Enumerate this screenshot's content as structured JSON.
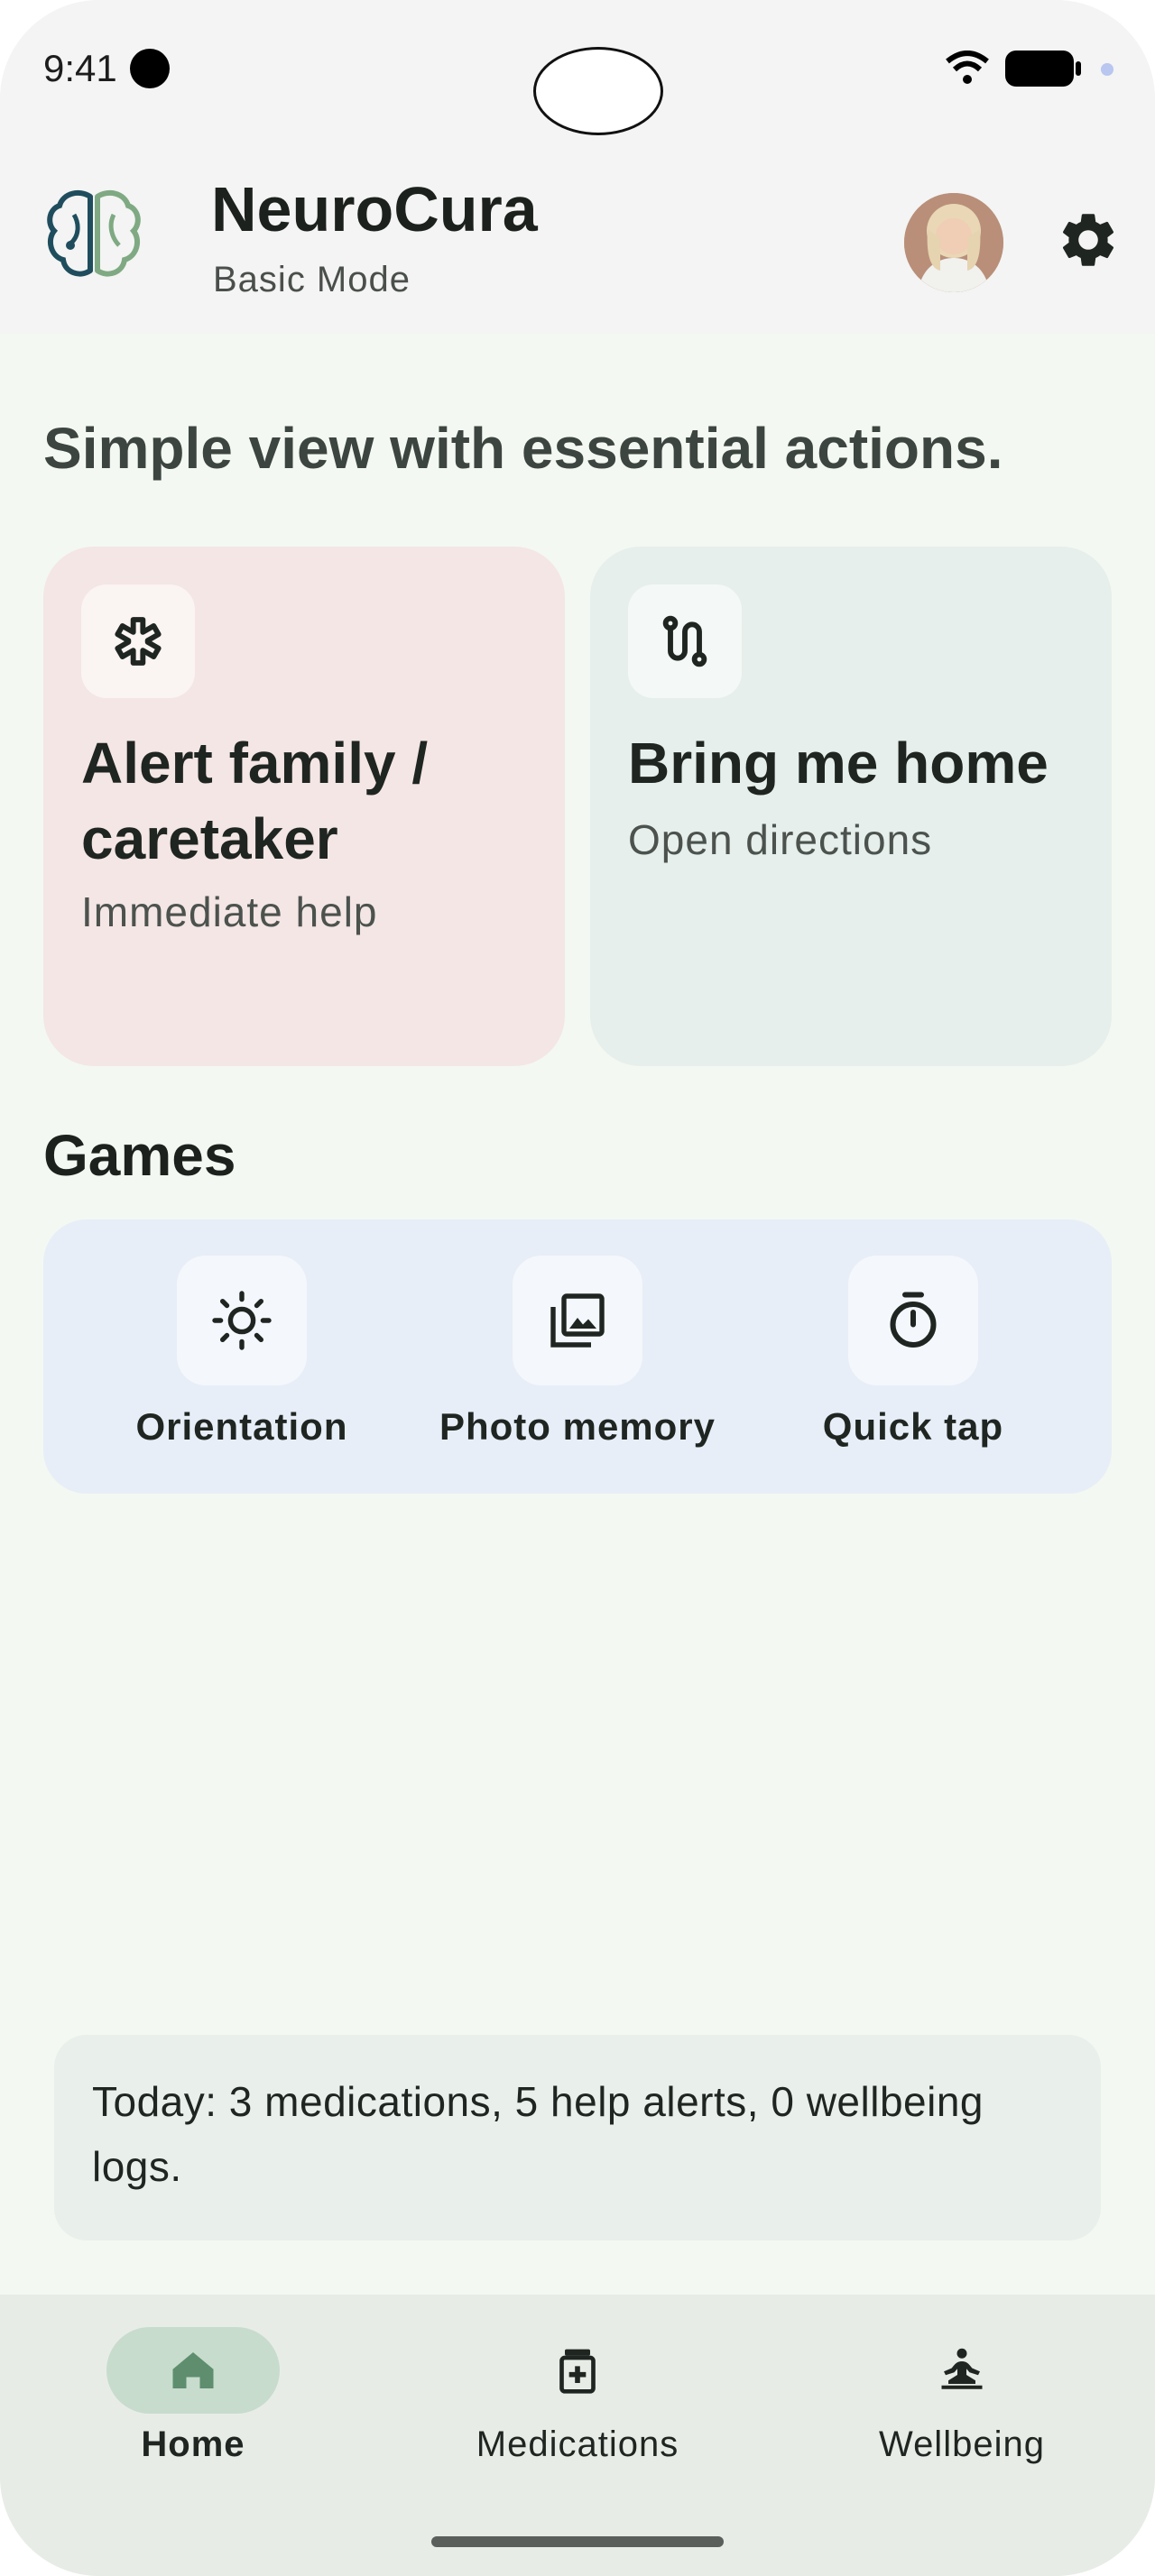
{
  "status_bar": {
    "time": "9:41"
  },
  "header": {
    "app_name": "NeuroCura",
    "mode": "Basic Mode",
    "logo_icon": "brain-logo-icon",
    "avatar_alt": "User profile photo",
    "settings_icon": "gear-icon"
  },
  "main": {
    "lead": "Simple view with essential actions.",
    "cards": [
      {
        "title": "Alert family / caretaker",
        "subtitle": "Immediate help",
        "icon": "asterisk-icon",
        "color": "#f4e6e5"
      },
      {
        "title": "Bring me home",
        "subtitle": "Open directions",
        "icon": "route-icon",
        "color": "#e6efeb"
      }
    ]
  },
  "games": {
    "title": "Games",
    "items": [
      {
        "label": "Orientation",
        "icon": "sun-icon"
      },
      {
        "label": "Photo memory",
        "icon": "photo-library-icon"
      },
      {
        "label": "Quick tap",
        "icon": "timer-icon"
      }
    ]
  },
  "summary": {
    "text": "Today: 3 medications, 5 help alerts, 0 wellbeing logs."
  },
  "bottom_nav": {
    "items": [
      {
        "label": "Home",
        "icon": "home-icon",
        "active": true
      },
      {
        "label": "Medications",
        "icon": "medication-icon",
        "active": false
      },
      {
        "label": "Wellbeing",
        "icon": "meditation-icon",
        "active": false
      }
    ]
  },
  "colors": {
    "accent": "#5e8e6e",
    "background": "#f3f8f2",
    "nav_active": "#c7dccd"
  }
}
